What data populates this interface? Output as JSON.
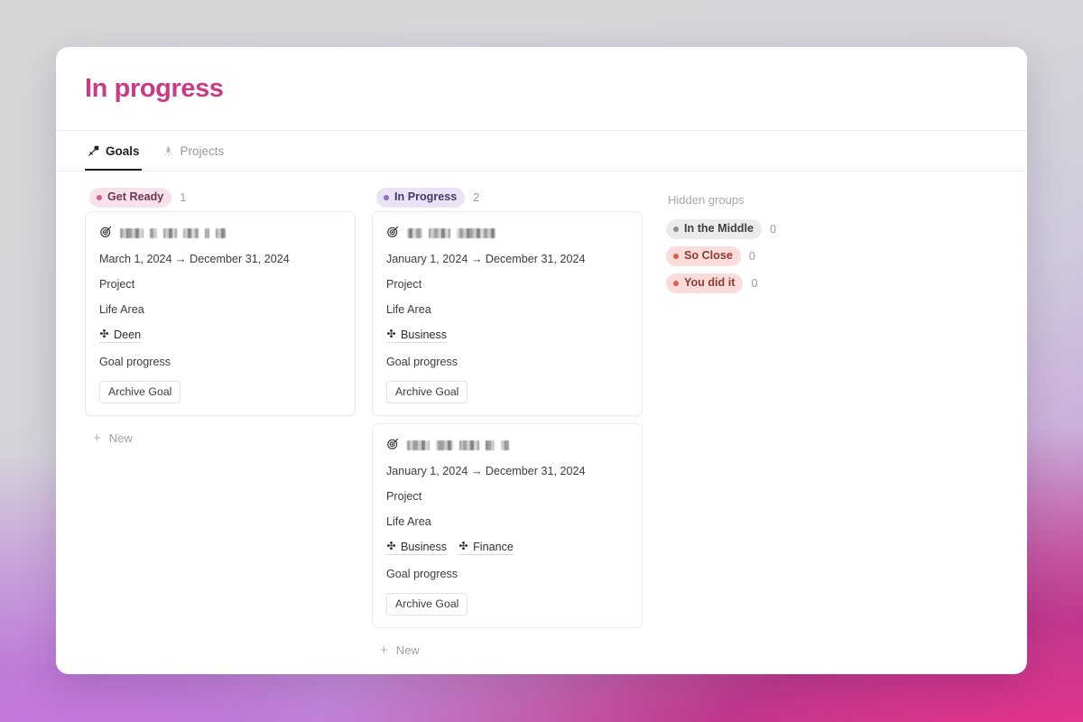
{
  "window": {
    "title": "In progress"
  },
  "tabs": [
    {
      "label": "Goals",
      "icon": "bow-and-arrow-icon",
      "glyph": "🏹",
      "active": true
    },
    {
      "label": "Projects",
      "icon": "rocket-icon",
      "glyph": "🚀",
      "active": false
    }
  ],
  "board": {
    "columns": [
      {
        "group": {
          "label": "Get Ready",
          "count": "1",
          "dot_color": "#cf5f94",
          "bg_color": "#f7e2ec",
          "text_color": "#6f3550"
        },
        "new_label": "New",
        "cards": [
          {
            "icon": "target-icon",
            "glyph": "🎯",
            "title_redacted": true,
            "redaction_widths": [
              26,
              8,
              15,
              17,
              5,
              11
            ],
            "dates": "March 1, 2024 → December 31, 2024",
            "fields": [
              "Project",
              "Life Area"
            ],
            "relations": [
              {
                "label": "Deen",
                "icon": "flower-icon",
                "glyph": "⚜"
              }
            ],
            "progress_label": "Goal progress",
            "archive_label": "Archive Goal"
          }
        ]
      },
      {
        "group": {
          "label": "In Progress",
          "count": "2",
          "dot_color": "#8b6fc4",
          "bg_color": "#eae2f5",
          "text_color": "#4a3a68"
        },
        "new_label": "New",
        "cards": [
          {
            "icon": "target-icon",
            "glyph": "🎯",
            "title_redacted": true,
            "redaction_widths": [
              17,
              24,
              43
            ],
            "dates": "January 1, 2024 → December 31, 2024",
            "fields": [
              "Project",
              "Life Area"
            ],
            "relations": [
              {
                "label": "Business",
                "icon": "flower-icon",
                "glyph": "⚜"
              }
            ],
            "progress_label": "Goal progress",
            "archive_label": "Archive Goal"
          },
          {
            "icon": "target-icon",
            "glyph": "🎯",
            "title_redacted": true,
            "redaction_widths": [
              25,
              19,
              22,
              10,
              9
            ],
            "dates": "January 1, 2024 → December 31, 2024",
            "fields": [
              "Project",
              "Life Area"
            ],
            "relations": [
              {
                "label": "Business",
                "icon": "flower-icon",
                "glyph": "⚜"
              },
              {
                "label": "Finance",
                "icon": "flower-icon",
                "glyph": "⚜"
              }
            ],
            "progress_label": "Goal progress",
            "archive_label": "Archive Goal"
          }
        ]
      }
    ]
  },
  "hidden_groups": {
    "title": "Hidden groups",
    "items": [
      {
        "label": "In the Middle",
        "count": "0",
        "dot_color": "#8a8a8a",
        "bg_color": "#ebebeb",
        "text_color": "#3f3f3f"
      },
      {
        "label": "So Close",
        "count": "0",
        "dot_color": "#e05d4e",
        "bg_color": "#fadddb",
        "text_color": "#8c3a31"
      },
      {
        "label": "You did it",
        "count": "0",
        "dot_color": "#e05d4e",
        "bg_color": "#fadddb",
        "text_color": "#8c3a31"
      }
    ]
  },
  "theme": {
    "title_color": "#c93b85",
    "window_bg": "#ffffff",
    "desktop_top": "#d6d6d8",
    "desktop_accent_pink": "#f0337f",
    "desktop_accent_purple": "#cf71df"
  }
}
